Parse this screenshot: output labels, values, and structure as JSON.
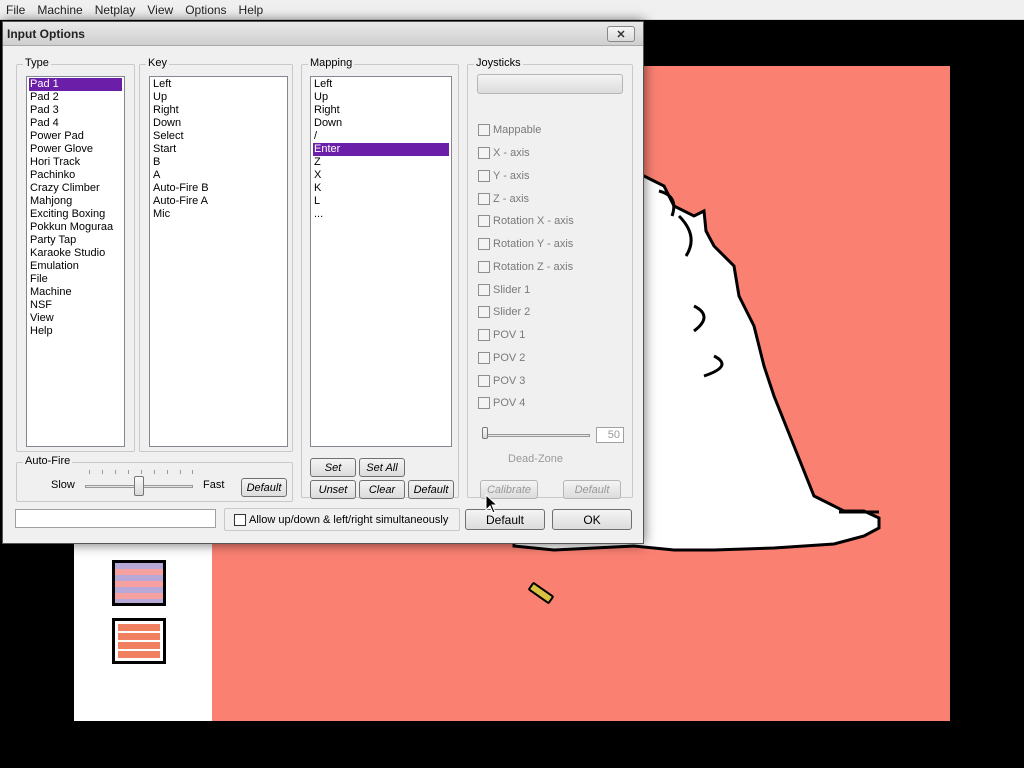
{
  "menubar": {
    "items": [
      "File",
      "Machine",
      "Netplay",
      "View",
      "Options",
      "Help"
    ]
  },
  "dialog": {
    "title": "Input Options",
    "close_glyph": "✕",
    "type": {
      "label": "Type",
      "items": [
        "Pad 1",
        "Pad 2",
        "Pad 3",
        "Pad 4",
        "Power Pad",
        "Power Glove",
        "Hori Track",
        "Pachinko",
        "Crazy Climber",
        "Mahjong",
        "Exciting Boxing",
        "Pokkun Moguraa",
        "Party Tap",
        "Karaoke Studio",
        "Emulation",
        "File",
        "Machine",
        "NSF",
        "View",
        "Help"
      ],
      "selected": "Pad 1"
    },
    "key": {
      "label": "Key",
      "items": [
        "Left",
        "Up",
        "Right",
        "Down",
        "Select",
        "Start",
        "B",
        "A",
        "Auto-Fire B",
        "Auto-Fire A",
        "Mic"
      ]
    },
    "mapping": {
      "label": "Mapping",
      "items": [
        "Left",
        "Up",
        "Right",
        "Down",
        "/",
        "Enter",
        "Z",
        "X",
        "K",
        "L",
        "..."
      ],
      "selected": "Enter",
      "set_label": "Set",
      "set_all_label": "Set All",
      "unset_label": "Unset",
      "clear_label": "Clear",
      "default_label": "Default"
    },
    "joysticks": {
      "label": "Joysticks",
      "selector_value": "",
      "checkboxes": [
        "Mappable",
        "X - axis",
        "Y - axis",
        "Z - axis",
        "Rotation X - axis",
        "Rotation Y - axis",
        "Rotation Z - axis",
        "Slider 1",
        "Slider 2",
        "POV 1",
        "POV 2",
        "POV 3",
        "POV 4"
      ],
      "deadzone_value": "50",
      "deadzone_fraction": 0,
      "deadzone_label": "Dead-Zone",
      "calibrate_label": "Calibrate",
      "default_label": "Default"
    },
    "autofire": {
      "label": "Auto-Fire",
      "slow_label": "Slow",
      "fast_label": "Fast",
      "level_fraction": 0.5,
      "default_label": "Default"
    },
    "footer": {
      "status_value": "",
      "allow_label": "Allow up/down & left/right simultaneously",
      "default_label": "Default",
      "ok_label": "OK"
    }
  },
  "colors": {
    "selection": "#6b1fa8",
    "game_bg": "#fa8072"
  }
}
